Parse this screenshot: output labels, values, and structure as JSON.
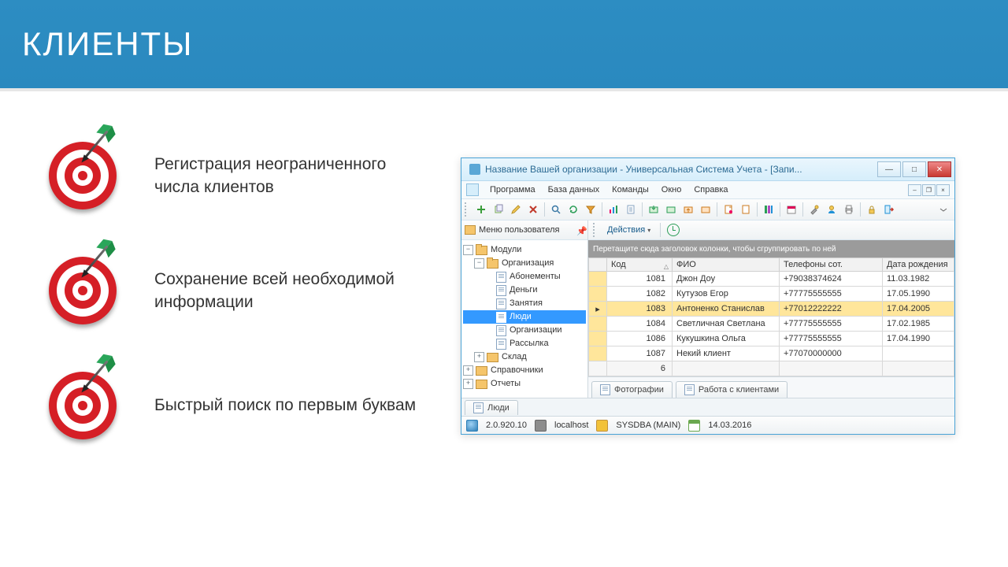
{
  "slide": {
    "title": "КЛИЕНТЫ",
    "bullets": [
      "Регистрация неограниченного числа клиентов",
      "Сохранение всей необходимой информации",
      "Быстрый поиск по первым буквам"
    ]
  },
  "app": {
    "title": "Название Вашей организации - Универсальная Система Учета - [Запи...",
    "menu": [
      "Программа",
      "База данных",
      "Команды",
      "Окно",
      "Справка"
    ],
    "usermenu_label": "Меню пользователя",
    "actions_label": "Действия",
    "group_hint": "Перетащите сюда заголовок колонки, чтобы сгруппировать по ней",
    "tree": {
      "root": "Модули",
      "org": "Организация",
      "org_children": [
        "Абонементы",
        "Деньги",
        "Занятия",
        "Люди",
        "Организации",
        "Рассылка"
      ],
      "sklad": "Склад",
      "sprav": "Справочники",
      "otch": "Отчеты",
      "selected": "Люди"
    },
    "columns": {
      "code": "Код",
      "fio": "ФИО",
      "phone": "Телефоны сот.",
      "dob": "Дата рождения"
    },
    "rows": [
      {
        "code": 1081,
        "fio": "Джон Доу",
        "phone": "+79038374624",
        "dob": "11.03.1982"
      },
      {
        "code": 1082,
        "fio": "Кутузов Егор",
        "phone": "+77775555555",
        "dob": "17.05.1990"
      },
      {
        "code": 1083,
        "fio": "Антоненко Станислав",
        "phone": "+77012222222",
        "dob": "17.04.2005"
      },
      {
        "code": 1084,
        "fio": "Светличная Светлана",
        "phone": "+77775555555",
        "dob": "17.02.1985"
      },
      {
        "code": 1086,
        "fio": "Кукушкина Ольга",
        "phone": "+77775555555",
        "dob": "17.04.1990"
      },
      {
        "code": 1087,
        "fio": "Некий клиент",
        "phone": "+77070000000",
        "dob": ""
      }
    ],
    "row_count": 6,
    "selected_row": 2,
    "bottom_tabs": [
      "Фотографии",
      "Работа с клиентами"
    ],
    "doc_tab": "Люди",
    "status": {
      "version": "2.0.920.10",
      "host": "localhost",
      "user": "SYSDBA (MAIN)",
      "date": "14.03.2016"
    }
  }
}
